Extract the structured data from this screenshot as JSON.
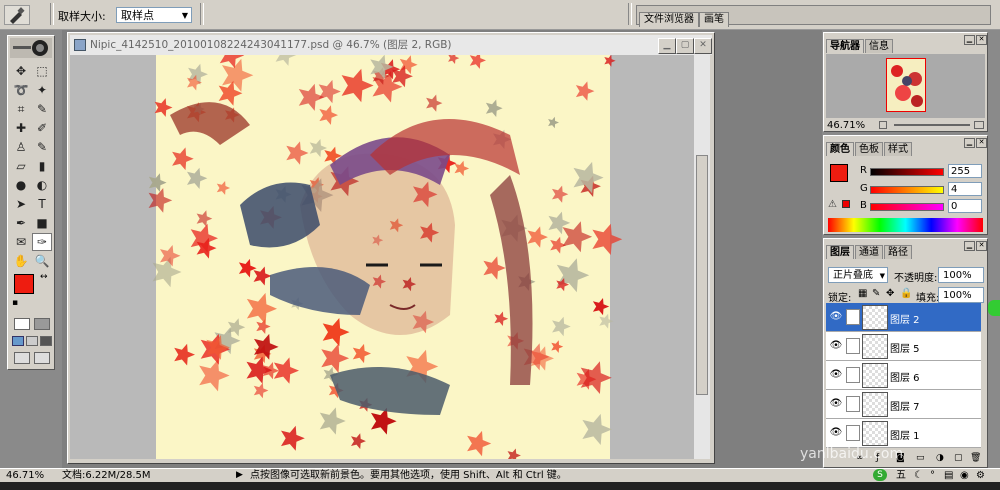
{
  "options_bar": {
    "tool_icon": "eyedropper-icon",
    "sample_size_label": "取样大小:",
    "sample_size_value": "取样点",
    "well_tabs": [
      "文件浏览器",
      "画笔"
    ]
  },
  "document": {
    "title": "Nipic_4142510_20100108224243041177.psd @ 46.7% (图层 2, RGB)",
    "icon": "photoshop-document-icon"
  },
  "tools": [
    {
      "name": "move-tool-icon",
      "glyph": "✥"
    },
    {
      "name": "marquee-tool-icon",
      "glyph": "⬚"
    },
    {
      "name": "lasso-tool-icon",
      "glyph": "➰"
    },
    {
      "name": "magic-wand-icon",
      "glyph": "✦"
    },
    {
      "name": "crop-tool-icon",
      "glyph": "⌗"
    },
    {
      "name": "slice-tool-icon",
      "glyph": "✎"
    },
    {
      "name": "healing-brush-icon",
      "glyph": "✚"
    },
    {
      "name": "brush-tool-icon",
      "glyph": "✐"
    },
    {
      "name": "clone-stamp-icon",
      "glyph": "♙"
    },
    {
      "name": "history-brush-icon",
      "glyph": "✎"
    },
    {
      "name": "eraser-tool-icon",
      "glyph": "▱"
    },
    {
      "name": "gradient-tool-icon",
      "glyph": "▮"
    },
    {
      "name": "blur-tool-icon",
      "glyph": "●"
    },
    {
      "name": "dodge-tool-icon",
      "glyph": "◐"
    },
    {
      "name": "path-select-icon",
      "glyph": "➤"
    },
    {
      "name": "type-tool-icon",
      "glyph": "T"
    },
    {
      "name": "pen-tool-icon",
      "glyph": "✒"
    },
    {
      "name": "shape-tool-icon",
      "glyph": "■"
    },
    {
      "name": "notes-tool-icon",
      "glyph": "✉"
    },
    {
      "name": "eyedropper-tool-icon",
      "glyph": "✑"
    },
    {
      "name": "hand-tool-icon",
      "glyph": "✋"
    },
    {
      "name": "zoom-tool-icon",
      "glyph": "🔍"
    }
  ],
  "foreground_color": "#ee1c10",
  "background_color": "#ffffff",
  "navigator": {
    "tabs": [
      "导航器",
      "信息"
    ],
    "zoom": "46.71%"
  },
  "color_panel": {
    "tabs": [
      "颜色",
      "色板",
      "样式"
    ],
    "r_label": "R",
    "r_value": "255",
    "g_label": "G",
    "g_value": "4",
    "b_label": "B",
    "b_value": "0"
  },
  "layers_panel": {
    "tabs": [
      "图层",
      "通道",
      "路径"
    ],
    "blend_mode": "正片叠底",
    "opacity_label": "不透明度:",
    "opacity_value": "100%",
    "lock_label": "锁定:",
    "fill_label": "填充:",
    "fill_value": "100%",
    "layers": [
      {
        "name": "图层 2",
        "selected": true
      },
      {
        "name": "图层 5",
        "selected": false
      },
      {
        "name": "图层 6",
        "selected": false
      },
      {
        "name": "图层 7",
        "selected": false
      },
      {
        "name": "图层 1",
        "selected": false
      }
    ]
  },
  "status": {
    "zoom": "46.71%",
    "doc_info": "文档:6.22M/28.5M",
    "hint": "点按图像可选取新前景色。要用其他选项，使用 Shift、Alt 和 Ctrl 键。"
  },
  "watermark": "yanlbaidu.com",
  "tray_text": "五"
}
